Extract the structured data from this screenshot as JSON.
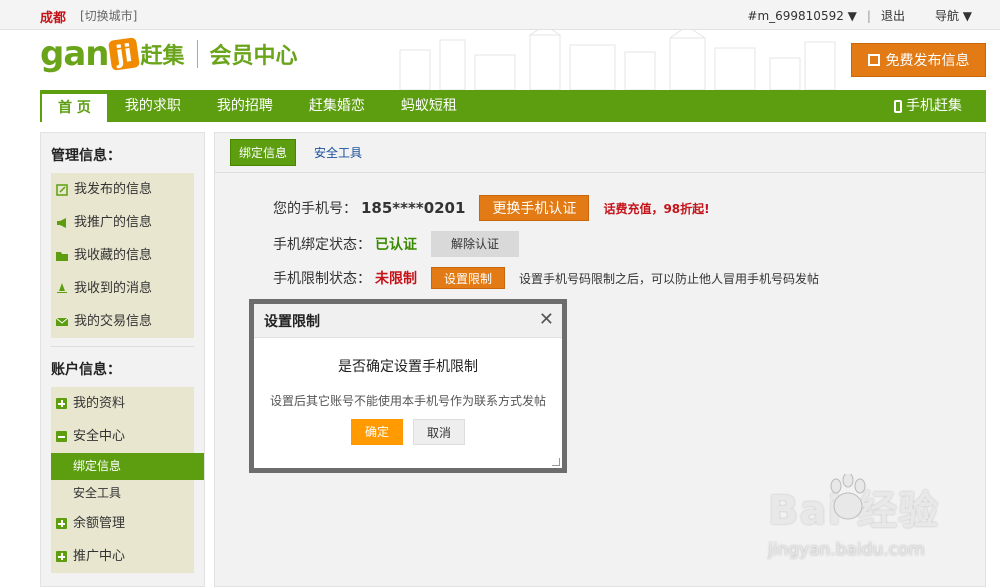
{
  "topbar": {
    "city": "成都",
    "switch_city": "[切换城市]",
    "user": "#m_699810592 ▼",
    "logout": "退出",
    "nav_menu": "导航 ▼"
  },
  "header": {
    "logo_gan": "gan",
    "logo_ji": "ji",
    "logo_ganji": "赶集",
    "logo_member": "会员中心",
    "publish_label": "免费发布信息"
  },
  "nav": {
    "items": [
      "首 页",
      "我的求职",
      "我的招聘",
      "赶集婚恋",
      "蚂蚁短租"
    ],
    "mobile": "手机赶集"
  },
  "sidebar": {
    "manage_title": "管理信息：",
    "manage_items": [
      "我发布的信息",
      "我推广的信息",
      "我收藏的信息",
      "我收到的消息",
      "我的交易信息"
    ],
    "account_title": "账户信息：",
    "account_items": {
      "profile": "我的资料",
      "security": "安全中心",
      "bind": "绑定信息",
      "tools": "安全工具",
      "balance": "余额管理",
      "promo": "推广中心"
    }
  },
  "main": {
    "tabs": [
      "绑定信息",
      "安全工具"
    ],
    "phone_label": "您的手机号：",
    "phone_value": "185****0201",
    "change_btn": "更换手机认证",
    "recharge": "话费充值，98折起!",
    "bind_label": "手机绑定状态：",
    "bind_value": "已认证",
    "unbind_btn": "解除认证",
    "limit_label": "手机限制状态：",
    "limit_value": "未限制",
    "limit_btn": "设置限制",
    "limit_hint": "设置手机号码限制之后，可以防止他人冒用手机号码发帖"
  },
  "modal": {
    "title": "设置限制",
    "close": "✕",
    "question": "是否确定设置手机限制",
    "note": "设置后其它账号不能使用本手机号作为联系方式发帖",
    "ok": "确定",
    "cancel": "取消"
  },
  "watermark": {
    "logo": "Bai  经验",
    "url": "jingyan.baidu.com"
  },
  "colors": {
    "brand_green": "#5c9e10",
    "accent_orange": "#e27a15",
    "alert_red": "#c4141a"
  }
}
